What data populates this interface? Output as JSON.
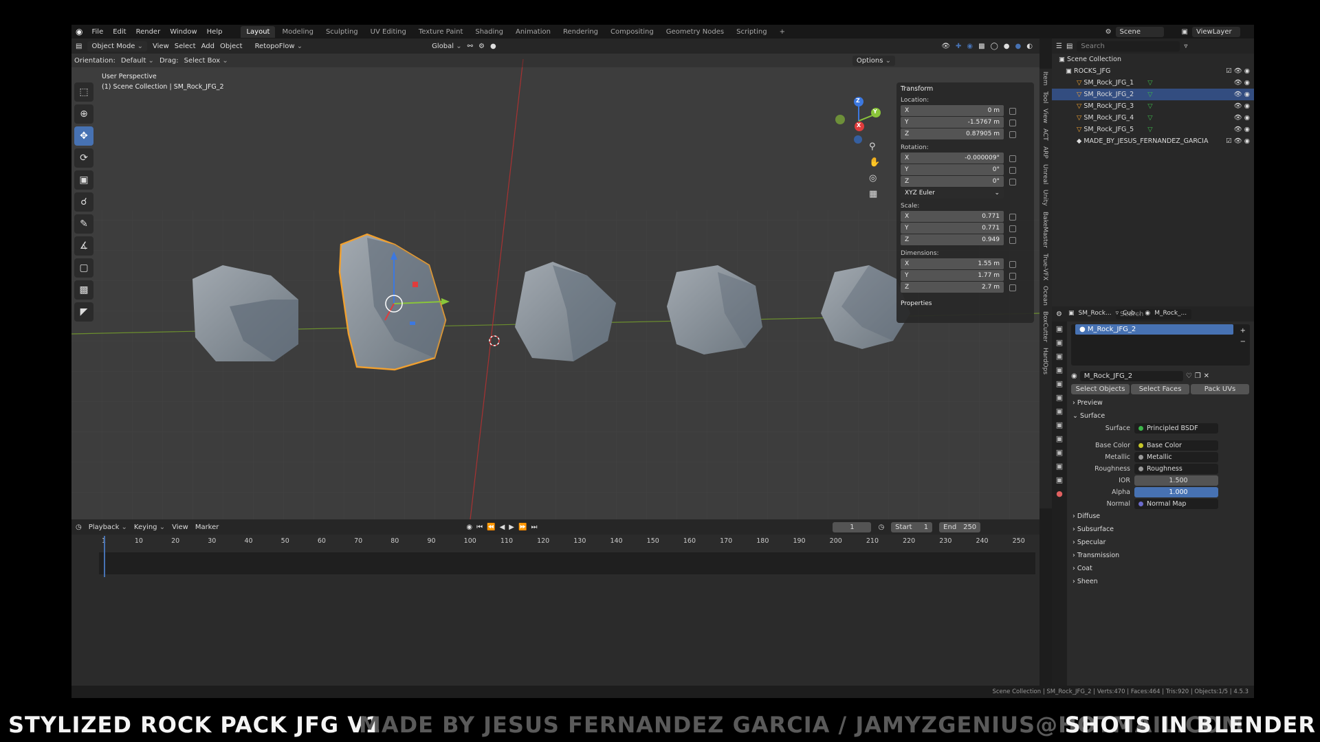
{
  "menu": [
    "File",
    "Edit",
    "Render",
    "Window",
    "Help"
  ],
  "workspace_tabs": [
    "Layout",
    "Modeling",
    "Sculpting",
    "UV Editing",
    "Texture Paint",
    "Shading",
    "Animation",
    "Rendering",
    "Compositing",
    "Geometry Nodes",
    "Scripting"
  ],
  "add_tab": "+",
  "header": {
    "scene": "Scene",
    "view_layer": "ViewLayer"
  },
  "viewport": {
    "mode": "Object Mode",
    "menus": [
      "View",
      "Select",
      "Add",
      "Object"
    ],
    "addon": "RetopoFlow",
    "transform_space": "Global",
    "orientation_label": "Orientation:",
    "orientation_value": "Default",
    "drag_label": "Drag:",
    "drag_value": "Select Box",
    "options": "Options",
    "perspective": "User Perspective",
    "collection_path": "(1) Scene Collection | SM_Rock_JFG_2",
    "gizmo_axes": [
      "Z",
      "Y",
      "X"
    ]
  },
  "npanel": {
    "title": "Transform",
    "location_label": "Location:",
    "location": [
      {
        "axis": "X",
        "value": "0 m"
      },
      {
        "axis": "Y",
        "value": "-1.5767 m"
      },
      {
        "axis": "Z",
        "value": "0.87905 m"
      }
    ],
    "rotation_label": "Rotation:",
    "rotation": [
      {
        "axis": "X",
        "value": "-0.000009°"
      },
      {
        "axis": "Y",
        "value": "0°"
      },
      {
        "axis": "Z",
        "value": "0°"
      }
    ],
    "rotation_mode": "XYZ Euler",
    "scale_label": "Scale:",
    "scale": [
      {
        "axis": "X",
        "value": "0.771"
      },
      {
        "axis": "Y",
        "value": "0.771"
      },
      {
        "axis": "Z",
        "value": "0.949"
      }
    ],
    "dimensions_label": "Dimensions:",
    "dimensions": [
      {
        "axis": "X",
        "value": "1.55 m"
      },
      {
        "axis": "Y",
        "value": "1.77 m"
      },
      {
        "axis": "Z",
        "value": "2.7 m"
      }
    ],
    "properties": "Properties",
    "side_tabs": [
      "Item",
      "Tool",
      "View",
      "ACT",
      "ARP",
      "Unreal",
      "Unity",
      "BakeMaster",
      "True-VFX",
      "Ocean",
      "BoxCutter",
      "HardOps"
    ]
  },
  "outliner": {
    "search_placeholder": "Search",
    "root": "Scene Collection",
    "collection": "ROCKS_JFG",
    "items": [
      "SM_Rock_JFG_1",
      "SM_Rock_JFG_2",
      "SM_Rock_JFG_3",
      "SM_Rock_JFG_4",
      "SM_Rock_JFG_5"
    ],
    "selected_index": 1,
    "extra": "MADE_BY_JESUS_FERNANDEZ_GARCIA"
  },
  "properties": {
    "search_placeholder": "Search",
    "breadcrumb": [
      "SM_Rock...",
      "Cub...",
      "M_Rock_..."
    ],
    "slot": "M_Rock_JFG_2",
    "material_name": "M_Rock_JFG_2",
    "buttons": [
      "Select Objects",
      "Select Faces",
      "Pack UVs"
    ],
    "preview": "Preview",
    "surface_section": "Surface",
    "surface_label": "Surface",
    "surface_value": "Principled BSDF",
    "inputs": [
      {
        "label": "Base Color",
        "value": "Base Color",
        "kind": "link",
        "dot": "yellow"
      },
      {
        "label": "Metallic",
        "value": "Metallic",
        "kind": "link",
        "dot": "grey"
      },
      {
        "label": "Roughness",
        "value": "Roughness",
        "kind": "link",
        "dot": "grey"
      },
      {
        "label": "IOR",
        "value": "1.500",
        "kind": "num",
        "dot": "grey"
      },
      {
        "label": "Alpha",
        "value": "1.000",
        "kind": "blue",
        "dot": "grey"
      },
      {
        "label": "Normal",
        "value": "Normal Map",
        "kind": "link",
        "dot": "purple"
      }
    ],
    "subsections": [
      "Diffuse",
      "Subsurface",
      "Specular",
      "Transmission",
      "Coat",
      "Sheen"
    ]
  },
  "timeline": {
    "menus": [
      "Playback",
      "Keying",
      "View",
      "Marker"
    ],
    "current_frame": "1",
    "start_label": "Start",
    "start": "1",
    "end_label": "End",
    "end": "250",
    "ticks": [
      "1",
      "10",
      "20",
      "30",
      "40",
      "50",
      "60",
      "70",
      "80",
      "90",
      "100",
      "110",
      "120",
      "130",
      "140",
      "150",
      "160",
      "170",
      "180",
      "190",
      "200",
      "210",
      "220",
      "230",
      "240",
      "250"
    ]
  },
  "status_bar": "Scene Collection | SM_Rock_JFG_2 | Verts:470 | Faces:464 | Tris:920 | Objects:1/5 | 4.5.3",
  "captions": {
    "left": "STYLIZED ROCK PACK JFG V1",
    "center": "MADE BY JESUS FERNANDEZ GARCIA / JAMYZGENIUS@HOTMAIL.COM",
    "right": "SHOTS IN BLENDER"
  },
  "colors": {
    "accent": "#4772b3",
    "selection": "#f0a030",
    "x_axis": "#e03c3c",
    "y_axis": "#8ac53a",
    "z_axis": "#3c78e0"
  }
}
